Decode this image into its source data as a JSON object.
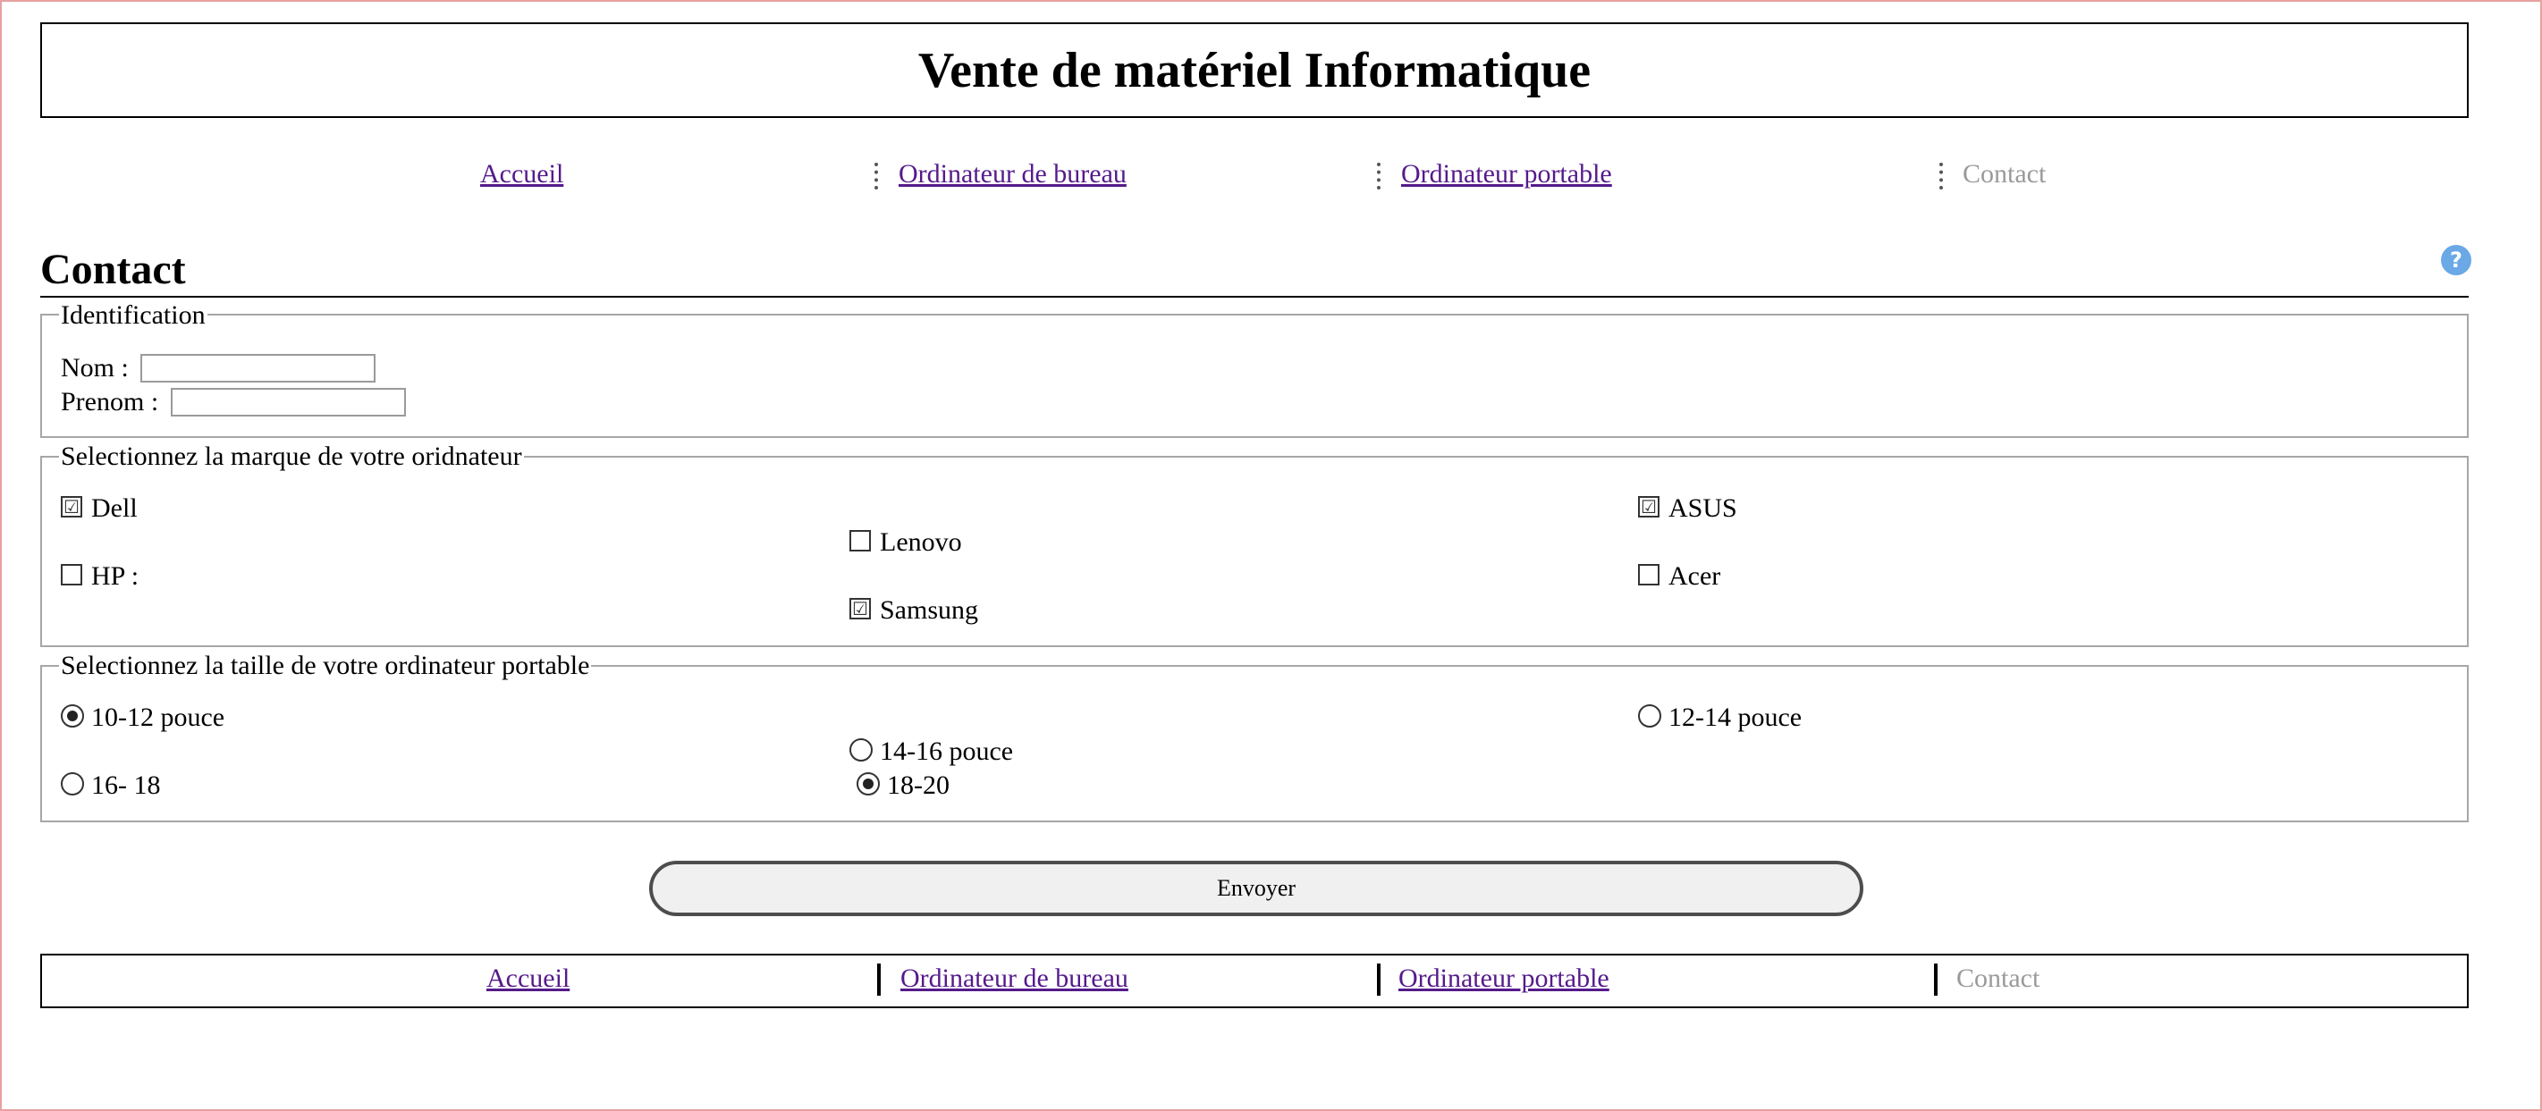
{
  "header": {
    "title": "Vente de matériel Informatique"
  },
  "nav": {
    "items": [
      {
        "label": "Accueil"
      },
      {
        "label": "Ordinateur de bureau"
      },
      {
        "label": "Ordinateur portable"
      },
      {
        "label": "Contact"
      }
    ]
  },
  "page": {
    "title": "Contact",
    "help_icon": "question-circle-icon",
    "help_glyph": "?"
  },
  "identification": {
    "legend": "Identification",
    "nom_label": "Nom :",
    "nom_value": "",
    "prenom_label": "Prenom :",
    "prenom_value": ""
  },
  "brands": {
    "legend": "Selectionnez la marque de votre oridnateur",
    "options": [
      {
        "label": "Dell",
        "checked": true
      },
      {
        "label": "Lenovo",
        "checked": false
      },
      {
        "label": "ASUS",
        "checked": true
      },
      {
        "label": "HP :",
        "checked": false
      },
      {
        "label": "Acer",
        "checked": false
      },
      {
        "label": "Samsung",
        "checked": true
      }
    ]
  },
  "sizes": {
    "legend": "Selectionnez la taille de votre ordinateur portable",
    "options": [
      {
        "label": "10-12 pouce",
        "selected": true
      },
      {
        "label": "12-14 pouce",
        "selected": false
      },
      {
        "label": "14-16 pouce",
        "selected": false
      },
      {
        "label": "16- 18",
        "selected": false
      },
      {
        "label": "18-20",
        "selected": true
      }
    ]
  },
  "form": {
    "submit_label": "Envoyer"
  },
  "footer": {
    "items": [
      {
        "label": "Accueil"
      },
      {
        "label": "Ordinateur de bureau"
      },
      {
        "label": "Ordinateur portable"
      },
      {
        "label": "Contact"
      }
    ]
  },
  "colors": {
    "link": "#551a8b",
    "current": "#9a9a9a",
    "help": "#6aa8e6",
    "frame": "#e8a0a0"
  }
}
